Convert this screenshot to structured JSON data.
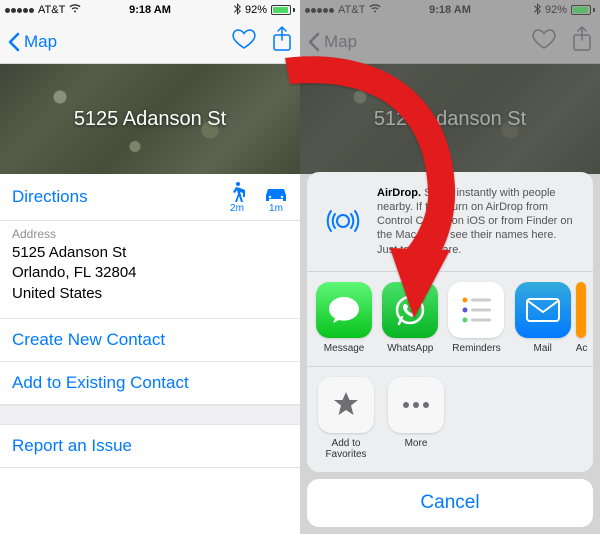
{
  "statusbar": {
    "carrier": "AT&T",
    "time": "9:18 AM",
    "battery_percent": "92%"
  },
  "nav": {
    "back_label": "Map"
  },
  "header": {
    "title": "5125 Adanson St"
  },
  "actions": {
    "directions_label": "Directions",
    "walk_time": "2m",
    "drive_time": "1m"
  },
  "address": {
    "section_label": "Address",
    "line1": "5125 Adanson St",
    "line2": "Orlando, FL  32804",
    "line3": "United States"
  },
  "links": {
    "create_contact": "Create New Contact",
    "add_existing": "Add to Existing Contact",
    "report_issue": "Report an Issue"
  },
  "share_sheet": {
    "airdrop_title": "AirDrop.",
    "airdrop_body": "Share instantly with people nearby. If they turn on AirDrop from Control Center on iOS or from Finder on the Mac, you'll see their names here. Just tap to share.",
    "apps": {
      "message": "Message",
      "whatsapp": "WhatsApp",
      "reminders": "Reminders",
      "mail": "Mail",
      "partial": "Ac"
    },
    "actions": {
      "add_favorites": "Add to Favorites",
      "more": "More"
    },
    "cancel": "Cancel"
  }
}
